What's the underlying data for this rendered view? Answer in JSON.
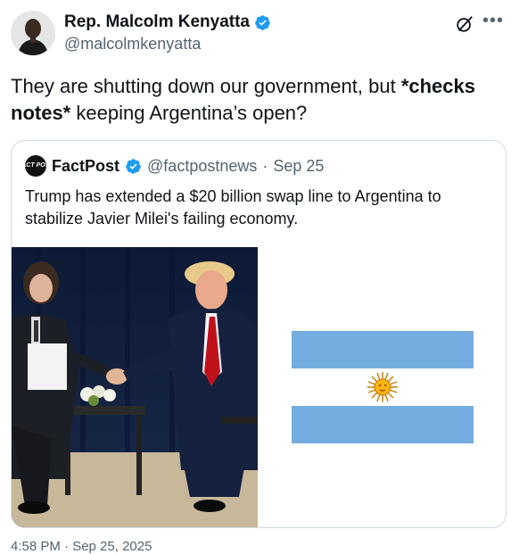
{
  "author": {
    "name": "Rep. Malcolm Kenyatta",
    "handle": "@malcolmkenyatta",
    "verified": true
  },
  "tweet": {
    "text_before": "They are shutting down our government, but ",
    "text_bold": "*checks notes*",
    "text_after": " keeping Argentina’s open?"
  },
  "quoted": {
    "avatar_text": "FACT POST",
    "name": "FactPost",
    "handle": "@factpostnews",
    "separator": "·",
    "date": "Sep 25",
    "text": "Trump has extended a $20 billion swap line to Argentina to stabilize Javier Milei's failing economy."
  },
  "footer": {
    "timestamp": "4:58 PM · Sep 25, 2025"
  },
  "colors": {
    "verified_blue": "#1d9bf0",
    "flag_blue": "#74acdf",
    "sun": "#f6b40e"
  },
  "icons": [
    "verified-badge-icon",
    "grok-icon",
    "more-icon"
  ]
}
